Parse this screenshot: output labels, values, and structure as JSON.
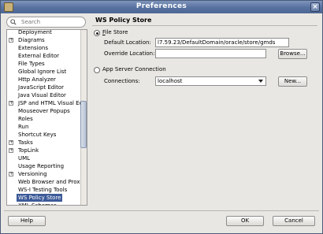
{
  "window": {
    "title": "Preferences"
  },
  "search": {
    "placeholder": "Search"
  },
  "tree": {
    "items": [
      {
        "label": "Deployment",
        "expandable": false,
        "selected": false
      },
      {
        "label": "Diagrams",
        "expandable": true,
        "selected": false
      },
      {
        "label": "Extensions",
        "expandable": false,
        "selected": false
      },
      {
        "label": "External Editor",
        "expandable": false,
        "selected": false
      },
      {
        "label": "File Types",
        "expandable": false,
        "selected": false
      },
      {
        "label": "Global Ignore List",
        "expandable": false,
        "selected": false
      },
      {
        "label": "Http Analyzer",
        "expandable": false,
        "selected": false
      },
      {
        "label": "JavaScript Editor",
        "expandable": false,
        "selected": false
      },
      {
        "label": "Java Visual Editor",
        "expandable": false,
        "selected": false
      },
      {
        "label": "JSP and HTML Visual Editor",
        "expandable": true,
        "selected": false
      },
      {
        "label": "Mouseover Popups",
        "expandable": false,
        "selected": false
      },
      {
        "label": "Roles",
        "expandable": false,
        "selected": false
      },
      {
        "label": "Run",
        "expandable": false,
        "selected": false
      },
      {
        "label": "Shortcut Keys",
        "expandable": false,
        "selected": false
      },
      {
        "label": "Tasks",
        "expandable": true,
        "selected": false
      },
      {
        "label": "TopLink",
        "expandable": true,
        "selected": false
      },
      {
        "label": "UML",
        "expandable": false,
        "selected": false
      },
      {
        "label": "Usage Reporting",
        "expandable": false,
        "selected": false
      },
      {
        "label": "Versioning",
        "expandable": true,
        "selected": false
      },
      {
        "label": "Web Browser and Proxy",
        "expandable": false,
        "selected": false
      },
      {
        "label": "WS-I Testing Tools",
        "expandable": false,
        "selected": false
      },
      {
        "label": "WS Policy Store",
        "expandable": false,
        "selected": true
      },
      {
        "label": "XML Schemas",
        "expandable": false,
        "selected": false
      }
    ]
  },
  "panel": {
    "title": "WS Policy Store",
    "file_store": {
      "label": "File Store",
      "checked": true,
      "default_location_label": "Default Location:",
      "default_location_value": "l7.59.23/DefaultDomain/oracle/store/gmds",
      "override_location_label": "Override Location:",
      "override_location_value": "",
      "browse_label": "Browse..."
    },
    "app_server": {
      "label": "App Server Connection",
      "checked": false,
      "connections_label": "Connections:",
      "connections_value": "localhost",
      "new_label": "New..."
    }
  },
  "footer": {
    "help_label": "Help",
    "ok_label": "OK",
    "cancel_label": "Cancel"
  }
}
